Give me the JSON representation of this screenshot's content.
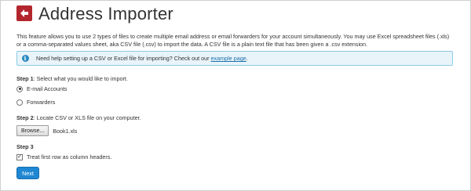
{
  "header": {
    "title": "Address Importer",
    "icon": "address-importer-icon"
  },
  "description": {
    "line1": "This feature allows you to use 2 types of files to create multiple email address or email forwarders for your account simultaneously. You may use Excel spreadsheet files (.xls)",
    "line2": "or a comma-separated values sheet, aka CSV file (.csv) to import the data. A CSV file is a plain text file that has been given a .csv extension."
  },
  "info": {
    "text": "Need help setting up a CSV or Excel file for importing? Check out our ",
    "link_text": "example page",
    "after_link": ".",
    "icon": "info-icon"
  },
  "step1": {
    "label_bold": "Step 1",
    "label_rest": ": Select what you would like to import.",
    "options": [
      {
        "label": "E-mail Accounts",
        "checked": true
      },
      {
        "label": "Forwarders",
        "checked": false
      }
    ]
  },
  "step2": {
    "label_bold": "Step 2",
    "label_rest": ": Locate CSV or XLS file on your computer.",
    "browse_label": "Browse...",
    "file_name": "Book1.xls"
  },
  "step3": {
    "label_bold": "Step 3",
    "checkbox_label": "Treat first row as column headers.",
    "checked": true
  },
  "next_label": "Next",
  "colors": {
    "accent": "#1f87d3",
    "info_bg": "#e8f4fa",
    "info_border": "#8ccbe6",
    "icon_red": "#b3262e"
  }
}
